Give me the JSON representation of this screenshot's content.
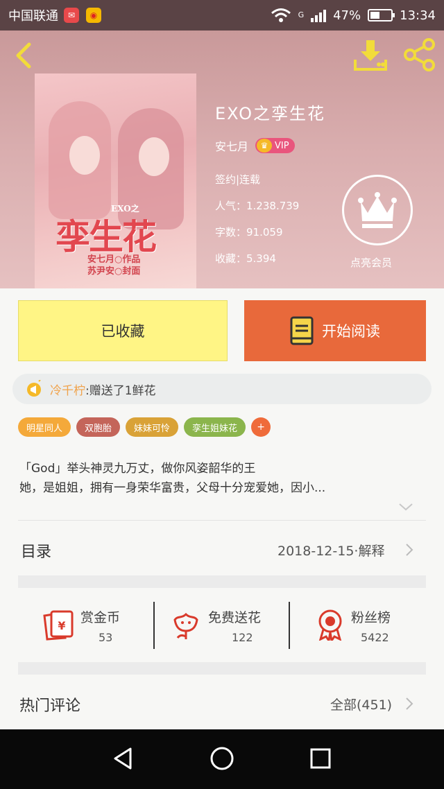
{
  "status_bar": {
    "carrier": "中国联通",
    "network": "G",
    "battery_percent": "47%",
    "battery_level": 0.47,
    "time": "13:34"
  },
  "header": {
    "back_icon": "chevron-left-icon",
    "download_icon": "download-icon",
    "share_icon": "share-icon"
  },
  "cover": {
    "sub": "EXO之",
    "title": "孪生花",
    "credit_author": "安七月○作品",
    "credit_designer": "苏尹安○封面"
  },
  "book": {
    "title": "EXO之孪生花",
    "author": "安七月",
    "vip_badge": "VIP",
    "status": "签约|连载",
    "popularity": "人气：1.238.739",
    "word_count": "字数：91.059",
    "favorites": "收藏：5.394",
    "member_label": "点亮会员"
  },
  "actions": {
    "collected_label": "已收藏",
    "read_label": "开始阅读"
  },
  "gift": {
    "user": "冷千柠",
    "text": ":赠送了1鲜花"
  },
  "tags": [
    {
      "label": "明星同人",
      "color": "#f4a93a"
    },
    {
      "label": "双胞胎",
      "color": "#c4655a"
    },
    {
      "label": "妹妹可怜",
      "color": "#d9a237"
    },
    {
      "label": "孪生姐妹花",
      "color": "#8bb54c"
    }
  ],
  "tag_add_label": "+",
  "description": {
    "line1": "「God」举头神灵九万丈，做你风姿韶华的王",
    "line2": "她，是姐姐，拥有一身荣华富贵，父母十分宠爱她，因小..."
  },
  "toc": {
    "label": "目录",
    "update": "2018-12-15·解释"
  },
  "stats": [
    {
      "label": "赏金币",
      "value": "53",
      "icon": "reward-coin-icon"
    },
    {
      "label": "免费送花",
      "value": "122",
      "icon": "flower-icon"
    },
    {
      "label": "粉丝榜",
      "value": "5422",
      "icon": "badge-ribbon-icon"
    }
  ],
  "comments": {
    "label": "热门评论",
    "all": "全部(451)"
  },
  "colors": {
    "header_bg": "#d4a4a5",
    "collected_bg": "#fff585",
    "read_bg": "#e8693b",
    "accent_red": "#d93a2b",
    "gift_user": "#f0a24a"
  }
}
